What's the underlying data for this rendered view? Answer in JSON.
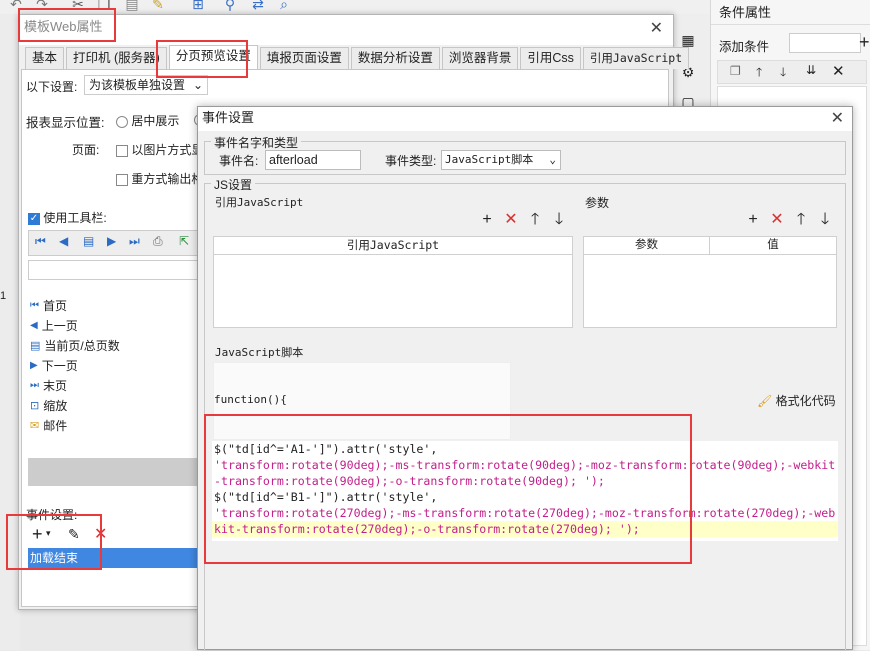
{
  "toolbar": {
    "hint": "toolbar"
  },
  "right_panel": {
    "title": "条件属性",
    "add_condition_label": "添加条件",
    "add_icon": "plus-icon"
  },
  "side_labels": {
    "left_text": "1"
  },
  "main_dialog": {
    "title": "模板Web属性",
    "tabs": [
      "基本",
      "打印机 (服务器)",
      "分页预览设置",
      "填报页面设置",
      "数据分析设置",
      "浏览器背景",
      "引用Css",
      "引用JavaScript"
    ],
    "active_tab": "分页预览设置",
    "settings_label": "以下设置:",
    "settings_select": "为该模板单独设置",
    "position_label": "报表显示位置:",
    "position_option_center": "居中展示",
    "page_label": "页面:",
    "page_option_image": "以图片方式显",
    "page_option_reprint": "重方式输出格",
    "use_toolbar_label": "使用工具栏:",
    "toolbar_items": [
      "首页",
      "上一页",
      "当前页/总页数",
      "下一页",
      "末页",
      "缩放",
      "邮件"
    ],
    "event_settings_label": "事件设置:",
    "event_list": [
      "加载结束"
    ]
  },
  "event_dialog": {
    "title": "事件设置",
    "name_type_legend": "事件名字和类型",
    "event_name_label": "事件名:",
    "event_name_value": "afterload",
    "event_type_label": "事件类型:",
    "event_type_value": "JavaScript脚本",
    "js_legend": "JS设置",
    "ref_js_label": "引用JavaScript",
    "ref_js_column": "引用JavaScript",
    "params_label": "参数",
    "params_col_name": "参数",
    "params_col_value": "值",
    "script_label": "JavaScript脚本",
    "function_header": "function(){",
    "format_code_label": "格式化代码",
    "code_lines": [
      "$(\"td[id^='A1-']\").attr('style',",
      "'transform:rotate(90deg);-ms-transform:rotate(90deg);-moz-transform:rotate(90deg);-webkit",
      "-transform:rotate(90deg);-o-transform:rotate(90deg); ');",
      "$(\"td[id^='B1-']\").attr('style',",
      "'transform:rotate(270deg);-ms-transform:rotate(270deg);-moz-transform:rotate(270deg);-web",
      "kit-transform:rotate(270deg);-o-transform:rotate(270deg); ');"
    ]
  }
}
